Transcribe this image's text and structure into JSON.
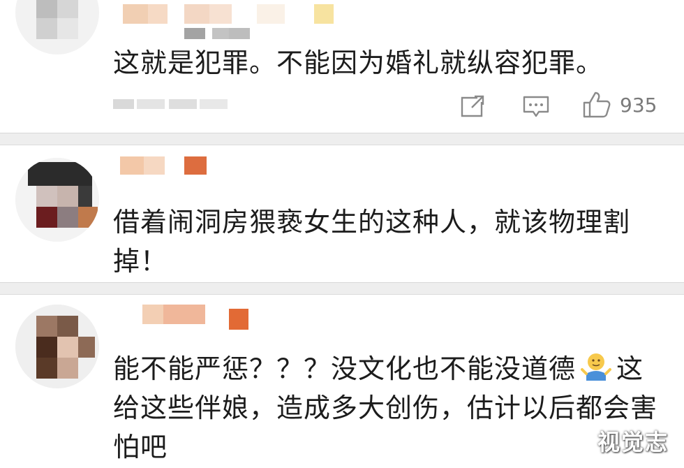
{
  "comments": [
    {
      "text": "这就是犯罪。不能因为婚礼就纵容犯罪。",
      "like_count": "935"
    },
    {
      "text": "借着闹洞房猥亵女生的这种人，就该物理割掉！"
    },
    {
      "text_before_emoji": "能不能严惩？？？没文化也不能没道德",
      "text_after_emoji": "这给这些伴娘，造成多大创伤，估计以后都会害怕吧",
      "emoji": "shrug-emoji"
    }
  ],
  "watermark": "视觉志",
  "icons": {
    "share": "share-icon",
    "reply": "comment-icon",
    "like": "thumbs-up-icon"
  },
  "colors": {
    "divider": "#eeeeee",
    "text": "#1c1c1c",
    "icon": "#8a8a8a"
  }
}
